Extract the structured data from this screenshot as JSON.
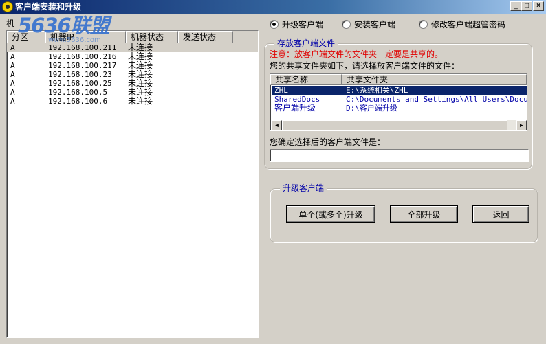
{
  "window": {
    "title": "客户端安装和升级",
    "min_glyph": "_",
    "max_glyph": "□",
    "close_glyph": "×"
  },
  "watermark": {
    "main": "5636联盟",
    "sub": "www.5636.com"
  },
  "machine_list": {
    "label": "机",
    "columns": [
      "分区",
      "机器IP",
      "机器状态",
      "发送状态"
    ],
    "rows": [
      {
        "zone": "A",
        "ip": "192.168.100.211",
        "status": "未连接",
        "send": ""
      },
      {
        "zone": "A",
        "ip": "192.168.100.216",
        "status": "未连接",
        "send": ""
      },
      {
        "zone": "A",
        "ip": "192.168.100.217",
        "status": "未连接",
        "send": ""
      },
      {
        "zone": "A",
        "ip": "192.168.100.23",
        "status": "未连接",
        "send": ""
      },
      {
        "zone": "A",
        "ip": "192.168.100.25",
        "status": "未连接",
        "send": ""
      },
      {
        "zone": "A",
        "ip": "192.168.100.5",
        "status": "未连接",
        "send": ""
      },
      {
        "zone": "A",
        "ip": "192.168.100.6",
        "status": "未连接",
        "send": ""
      }
    ]
  },
  "mode_options": [
    {
      "label": "升级客户端",
      "checked": true
    },
    {
      "label": "安装客户端",
      "checked": false
    },
    {
      "label": "修改客户端超管密码",
      "checked": false
    }
  ],
  "storage_group": {
    "title": "存放客户端文件",
    "warning": "注意：放客户端文件的文件夹一定要是共享的。",
    "instruction": "您的共享文件夹如下，请选择放客户端文件的文件：",
    "columns": [
      "共享名称",
      "共享文件夹"
    ],
    "rows": [
      {
        "name": "ZHL",
        "path": "E:\\系统相关\\ZHL",
        "selected": true
      },
      {
        "name": "SharedDocs",
        "path": "C:\\Documents and Settings\\All Users\\Documents",
        "selected": false
      },
      {
        "name": "客户端升级",
        "path": "D:\\客户端升级",
        "selected": false
      }
    ],
    "scroll_left_glyph": "◄",
    "scroll_right_glyph": "►",
    "confirm_label": "您确定选择后的客户端文件是：",
    "confirm_value": ""
  },
  "upgrade_group": {
    "title": "升级客户端",
    "single_button": "单个(或多个)升级",
    "all_button": "全部升级",
    "back_button": "返回"
  }
}
